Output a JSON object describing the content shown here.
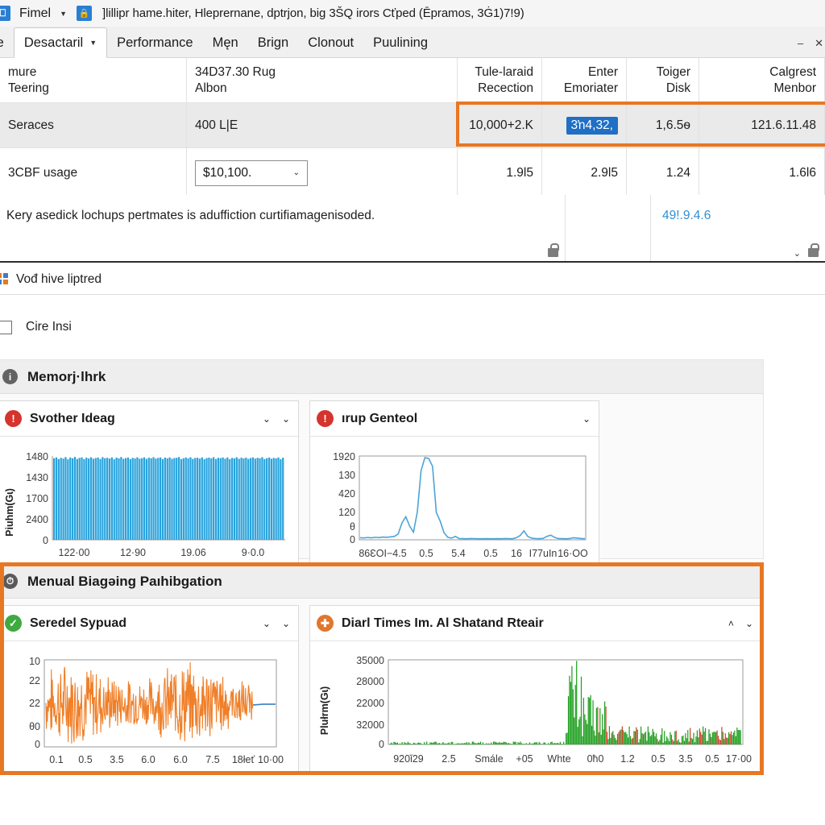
{
  "titlebar": {
    "app_icon": "window-restore-icon",
    "app_name": "Fimel",
    "caret": "▼",
    "doc_icon": "lock-badge-icon",
    "doc_title": "]lillipr hame.hiter, Hleprernane, dptrjon, big 3ŠQ irors Cťped (Ēpramos, 3Ġ1)7!9)"
  },
  "tabs": {
    "items": [
      {
        "label": "le",
        "active": false
      },
      {
        "label": "Desactaril",
        "active": true,
        "caret": "▼"
      },
      {
        "label": "Performance",
        "active": false
      },
      {
        "label": "Męn",
        "active": false
      },
      {
        "label": "Brign",
        "active": false
      },
      {
        "label": "Clonout",
        "active": false
      },
      {
        "label": "Puulining",
        "active": false
      }
    ],
    "window_controls": [
      "–",
      "✕"
    ]
  },
  "table": {
    "headers": [
      {
        "line1": "mure",
        "line2": "Teering"
      },
      {
        "line1": "34D37.30 Rug",
        "line2": "Albon"
      },
      {
        "line1": "Tule-laraid",
        "line2": "Recection"
      },
      {
        "line1": "Enter",
        "line2": "Emoriater"
      },
      {
        "line1": "Toiger",
        "line2": "Disk"
      },
      {
        "line1": "Calgrest",
        "line2": "Menbor"
      }
    ],
    "selected_row": {
      "name": "Seraces",
      "detail": "400 L|E",
      "col3": "10,000+2.K",
      "col4": "3ŉ4,32,",
      "col5": "1,6.5ѳ",
      "col6": "121.6.11.48"
    },
    "value_row": {
      "name": "3CBF usage",
      "dropdown_value": "$10,100.",
      "dropdown_caret": "⌄",
      "col3": "1.9l5",
      "col4": "2.9l5",
      "col5": "1.24",
      "col6": "1.6l6"
    }
  },
  "note": {
    "message": "Kery asedick lochups pertmates is aduffiction curtifiamagenisoded.",
    "link": "49!.9.4.6",
    "lock_icon": "lock-icon",
    "caret": "⌄"
  },
  "status": {
    "icon": "windows-flag-icon",
    "text": "Vođ hive liptred"
  },
  "checkbox": {
    "checked": false,
    "label": "Cire Insi"
  },
  "sections": [
    {
      "icon": "info-circle-icon",
      "title": "Memorј·lhrk",
      "cards": [
        {
          "status_icon": "error-circle-icon",
          "status_color": "#d5342c",
          "title": "Svother Ideag",
          "controls": [
            "⌄",
            "⌄"
          ]
        },
        {
          "status_icon": "error-circle-icon",
          "status_color": "#d5342c",
          "title": "ırup Genteol",
          "controls": [
            "⌄"
          ]
        }
      ]
    },
    {
      "icon": "clock-circle-icon",
      "title": "Menual Biagəing Paıhibgation",
      "cards": [
        {
          "status_icon": "check-circle-icon",
          "status_color": "#3faa3f",
          "title": "Seredel Sypuad",
          "controls": [
            "⌄",
            "⌄"
          ]
        },
        {
          "status_icon": "move-cross-icon",
          "status_color": "#e2762c",
          "title": "Diarl Times Im. Al Shatand Rteair",
          "controls": [
            "˄",
            "⌄"
          ]
        }
      ]
    }
  ],
  "chart_data": [
    {
      "type": "bar",
      "title": "Svother Ideag",
      "ylabel": "Piuhm(Gɩ)",
      "xlabel": "",
      "yticks": [
        "1480",
        "1430",
        "1700",
        "2400",
        "0"
      ],
      "xticks": [
        "122·00",
        "12·90",
        "19.06",
        "9·0.0"
      ],
      "ylim": [
        0,
        1480
      ],
      "series_color": "#29a3dc",
      "values": [
        1455,
        1470,
        1440,
        1462,
        1448,
        1475,
        1435,
        1468,
        1452,
        1478,
        1442,
        1460,
        1470,
        1438,
        1465,
        1450,
        1472,
        1445,
        1458,
        1468,
        1440,
        1474,
        1455,
        1462,
        1448,
        1470,
        1436,
        1466,
        1452,
        1476,
        1444,
        1458,
        1468,
        1438,
        1462,
        1450,
        1472,
        1446,
        1456,
        1470,
        1442,
        1464,
        1454,
        1474,
        1448,
        1460,
        1468,
        1440,
        1466,
        1452,
        1470,
        1444,
        1458,
        1462,
        1476,
        1438,
        1455,
        1468,
        1450,
        1472,
        1442,
        1460,
        1464,
        1448,
        1470,
        1436,
        1458,
        1466,
        1452,
        1474,
        1440,
        1462,
        1456,
        1468,
        1446,
        1470,
        1438,
        1460,
        1452,
        1472,
        1444,
        1464,
        1450,
        1466,
        1442,
        1458,
        1470,
        1448,
        1462,
        1454,
        1474,
        1440,
        1456,
        1468,
        1446,
        1460,
        1452,
        1470,
        1438,
        1464
      ]
    },
    {
      "type": "line",
      "title": "ırup Genteol",
      "ylabel": "",
      "yticks": [
        "1920",
        "130",
        "420",
        "120",
        "θ",
        "0"
      ],
      "xticks": [
        "86ƐOI−4.5",
        "0.5",
        "5.4",
        "0.5",
        "16",
        "I77uIn",
        "16·OO"
      ],
      "ylim": [
        0,
        1920
      ],
      "series_color": "#4da3d8",
      "values": [
        30,
        25,
        35,
        28,
        40,
        32,
        45,
        38,
        50,
        60,
        120,
        380,
        520,
        300,
        160,
        620,
        1600,
        1900,
        1880,
        1700,
        620,
        420,
        150,
        40,
        20,
        60,
        10,
        8,
        6,
        10,
        8,
        6,
        5,
        8,
        6,
        5,
        8,
        6,
        10,
        8,
        6,
        30,
        80,
        190,
        60,
        20,
        10,
        8,
        12,
        60,
        90,
        40,
        10,
        8,
        6,
        10,
        30,
        20,
        10,
        8
      ]
    },
    {
      "type": "line",
      "title": "Seredel Sypuad",
      "ylabel": "",
      "yticks": [
        "10",
        "22",
        "22",
        "θ0",
        "0"
      ],
      "xticks": [
        "0.1",
        "0.5",
        "3.5",
        "6.0",
        "6.0",
        "7.5",
        "18łeť",
        "10·00"
      ],
      "ylim": [
        0,
        10
      ],
      "series_color": "#f07f28",
      "tail_color": "#3a7ebf",
      "noise": true
    },
    {
      "type": "bar",
      "title": "Diarl Times Im. Al Shatand Rteair",
      "ylabel": "Plułrm(Gɩ)",
      "yticks": [
        "35000",
        "28000",
        "22000",
        "32000",
        "0"
      ],
      "xticks": [
        "920ǐ29",
        "2.5",
        "Smále",
        "+05",
        "Whte",
        "0ħ0",
        "1.2",
        "0.5",
        "3.5",
        "0.5",
        "17·00"
      ],
      "ylim": [
        0,
        35000
      ],
      "series_color": "#21a021",
      "series2_color": "#d0422a"
    }
  ],
  "colors": {
    "accent_orange": "#e87722",
    "selection_blue": "#1f6fc4",
    "link_blue": "#2e8fd6"
  }
}
